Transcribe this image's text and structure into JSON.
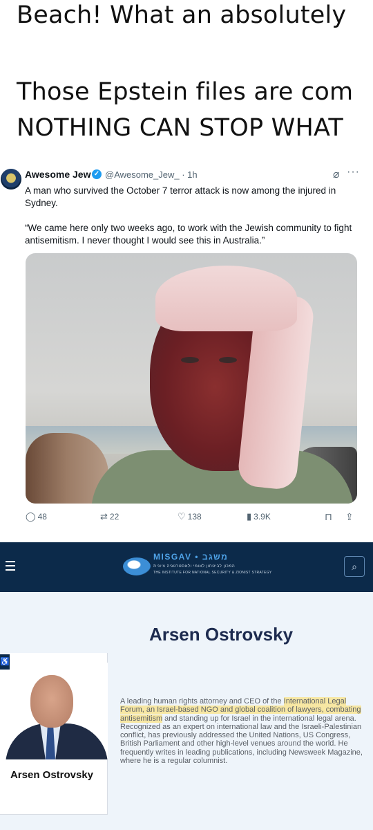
{
  "caption": {
    "line1": "Beach! What an absolutely",
    "line2": "Those Epstein files are com",
    "line3": "NOTHING CAN STOP WHAT"
  },
  "tweet": {
    "author_name": "Awesome Jew",
    "handle_time": "@Awesome_Jew_ · 1h",
    "text1": "A man who survived the October 7 terror attack is now among the injured in Sydney.",
    "text2": "“We came here only two weeks ago, to work with the Jewish community to fight antisemitism. I never thought I would see this in Australia.”",
    "stats": {
      "replies": "48",
      "reposts": "22",
      "likes": "138",
      "views": "3.9K"
    }
  },
  "site": {
    "logo_text": "MISGAV • משגב",
    "logo_sub_he": "המכון לביטחון לאומי ולאסטרטגיה ציונית",
    "logo_sub_en": "THE INSTITUTE FOR NATIONAL SECURITY & ZIONIST STRATEGY",
    "page_title": "Arsen Ostrovsky",
    "card_name": "Arsen Ostrovsky",
    "bio": {
      "p1": "A leading human rights attorney and CEO of the ",
      "p2": "International Legal Forum, an Israel-based NGO and global coalition of lawyers, combating antisemitism",
      "p3": " and standing up for Israel in the international legal arena. Recognized as an expert on international law and the Israeli-Palestinian conflict, has previously addressed the United Nations, US Congress, British Parliament and other high-level venues around the world. He frequently writes in leading publications, including Newsweek Magazine, where he is a regular columnist."
    },
    "colors": {
      "header_bg": "#0c2a4a",
      "page_bg": "#eef4fa",
      "highlight": "#f7e7a3",
      "title": "#1d2b4f"
    }
  },
  "icons": [
    "menu-icon",
    "search-icon",
    "reply-icon",
    "repost-icon",
    "like-icon",
    "views-icon",
    "bookmark-icon",
    "share-icon",
    "grok-icon",
    "more-icon",
    "verified-icon"
  ]
}
